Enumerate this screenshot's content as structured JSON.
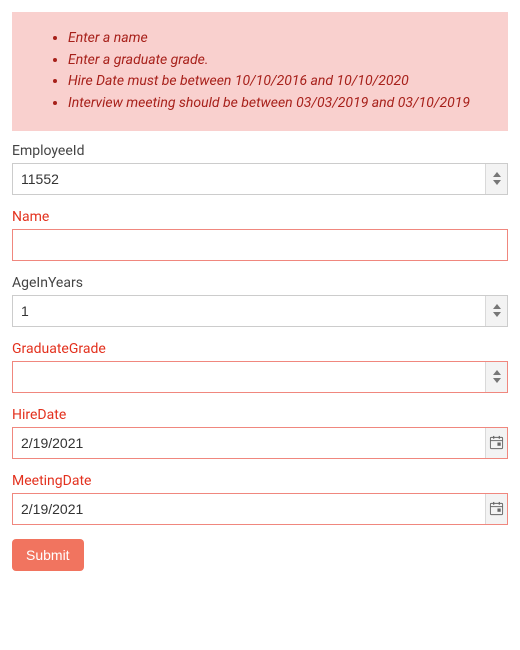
{
  "errors": [
    "Enter a name",
    "Enter a graduate grade.",
    "Hire Date must be between 10/10/2016 and 10/10/2020",
    "Interview meeting should be between 03/03/2019 and 03/10/2019"
  ],
  "fields": {
    "employeeId": {
      "label": "EmployeeId",
      "value": "11552",
      "error": false,
      "type": "number"
    },
    "name": {
      "label": "Name",
      "value": "",
      "error": true,
      "type": "text"
    },
    "ageInYears": {
      "label": "AgeInYears",
      "value": "1",
      "error": false,
      "type": "number"
    },
    "graduateGrade": {
      "label": "GraduateGrade",
      "value": "",
      "error": true,
      "type": "number"
    },
    "hireDate": {
      "label": "HireDate",
      "value": "2/19/2021",
      "error": true,
      "type": "date"
    },
    "meetingDate": {
      "label": "MeetingDate",
      "value": "2/19/2021",
      "error": true,
      "type": "date"
    }
  },
  "submit_label": "Submit"
}
